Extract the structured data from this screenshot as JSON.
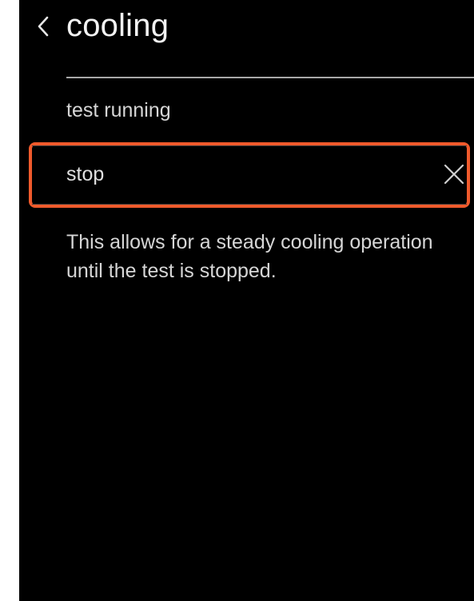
{
  "header": {
    "back_icon": "chevron-left-icon",
    "title": "cooling"
  },
  "status": {
    "text": "test running"
  },
  "stop_row": {
    "label": "stop",
    "close_icon": "close-icon",
    "highlight_color": "#f05a2c"
  },
  "description": {
    "text": "This allows for a steady cooling operation until the test is stopped."
  },
  "colors": {
    "background": "#000000",
    "text": "#e8e8e8",
    "divider": "#a8a8a8"
  }
}
